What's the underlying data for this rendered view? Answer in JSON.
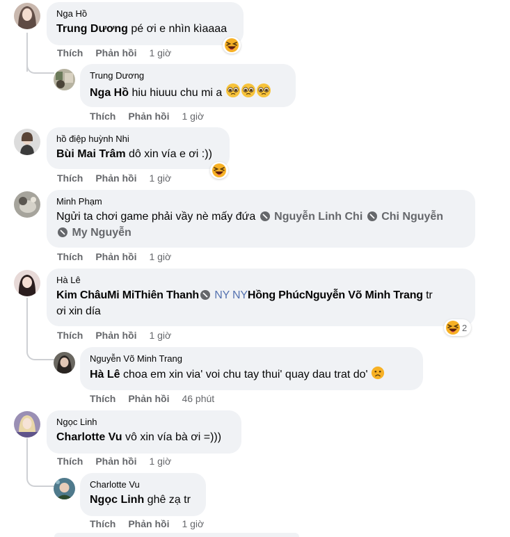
{
  "comments": [
    {
      "author": "Nga Hồ",
      "mention": "Trung Dương",
      "text": " pé ơi e nhìn kìaaaa",
      "like": "Thích",
      "reply": "Phản hồi",
      "time": "1 giờ"
    },
    {
      "author": "Trung Dương",
      "mention": "Nga Hồ",
      "text": " hiu hiuuu chu mi a ",
      "like": "Thích",
      "reply": "Phản hồi",
      "time": "1 giờ"
    },
    {
      "author": "hồ điệp huỳnh Nhi",
      "mention": "Bùi Mai Trâm",
      "text": " dô xin vía e ơi :))",
      "like": "Thích",
      "reply": "Phản hồi",
      "time": "1 giờ"
    },
    {
      "author": "Minh Phạm",
      "text": "Ngửi ta chơi game phải vầy nè mấy đứa ",
      "tag1": "Nguyễn Linh Chi",
      "tag2": "Chi Nguyễn",
      "tag3": "My Nguyễn",
      "like": "Thích",
      "reply": "Phản hồi",
      "time": "1 giờ"
    },
    {
      "author": "Hà Lê",
      "m1": "Kim Châu",
      "m2": "Mi Mi",
      "m3": "Thiên Thanh",
      "m4": "NY NY",
      "m5": "Hồng Phúc",
      "m6": "Nguyễn Võ Minh Trang",
      "tail1": " tr",
      "tail2": "ơi xin día",
      "reaction_count": "2",
      "like": "Thích",
      "reply": "Phản hồi",
      "time": "1 giờ"
    },
    {
      "author": "Nguyễn Võ Minh Trang",
      "mention": "Hà Lê",
      "text": " choa em xin via' voi chu tay thui' quay dau trat do' ",
      "like": "Thích",
      "reply": "Phản hồi",
      "time": "46 phút"
    },
    {
      "author": "Ngọc Linh",
      "mention": "Charlotte Vu",
      "text": " vô xin vía bà ơi =)))",
      "like": "Thích",
      "reply": "Phản hồi",
      "time": "1 giờ"
    },
    {
      "author": "Charlotte Vu",
      "mention": "Ngọc Linh",
      "text": " ghê zạ tr",
      "like": "Thích",
      "reply": "Phản hồi",
      "time": "1 giờ"
    }
  ],
  "icons": {
    "laugh": "laughing-emoji",
    "crying": "pleading-emoji",
    "sad": "sad-emoji",
    "verified": "verified-badge-icon"
  },
  "colors": {
    "bubble": "#f0f2f5",
    "meta": "#65676b",
    "text": "#050505",
    "thread": "#ced0d4",
    "tag_blue": "#5572b0"
  }
}
